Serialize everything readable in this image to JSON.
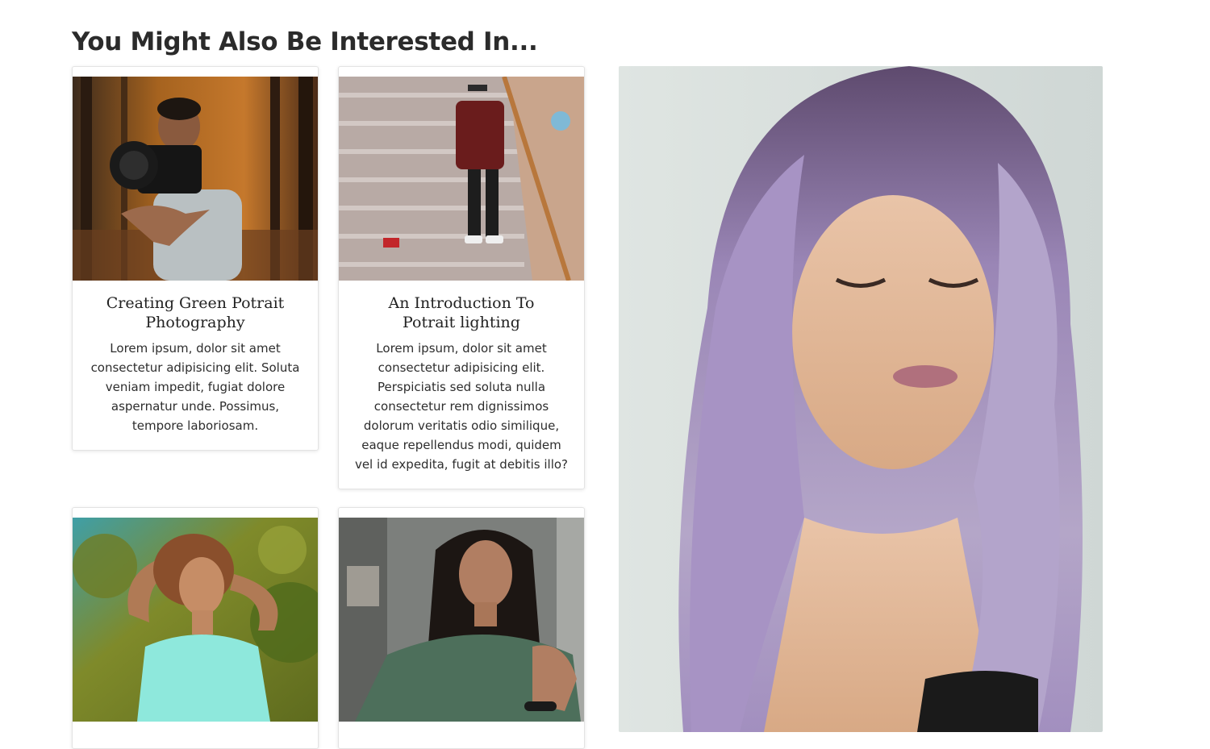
{
  "section": {
    "title": "You Might Also Be Interested In..."
  },
  "cards": [
    {
      "title": "Creating Green Potrait Photography",
      "description": "Lorem ipsum, dolor sit amet consectetur adipisicing elit. Soluta veniam impedit, fugiat dolore aspernatur unde. Possimus, tempore laboriosam."
    },
    {
      "title": "An Introduction To Potrait lighting",
      "description": "Lorem ipsum, dolor sit amet consectetur adipisicing elit. Perspiciatis sed soluta nulla consectetur rem dignissimos dolorum veritatis odio similique, eaque repellendus modi, quidem vel id expedita, fugit at debitis illo?"
    }
  ],
  "colors": {
    "heading": "#2b2b2b",
    "card_border": "#e3e3e3"
  }
}
